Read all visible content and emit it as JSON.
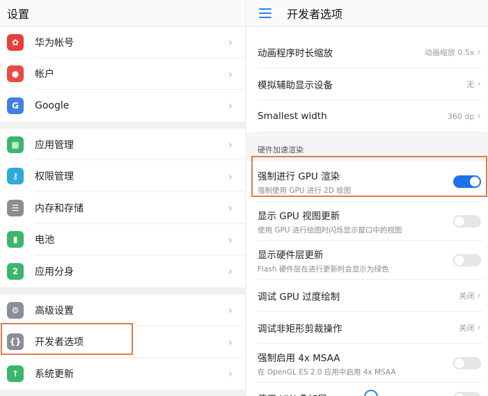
{
  "left": {
    "title": "设置",
    "groups": [
      [
        {
          "label": "华为帐号",
          "icon": "huawei-logo-icon",
          "color": "#e5403b",
          "glyph": "✿"
        },
        {
          "label": "帐户",
          "icon": "account-icon",
          "color": "#e94a43",
          "glyph": "●"
        },
        {
          "label": "Google",
          "icon": "google-icon",
          "color": "#3f7fe6",
          "glyph": "G"
        }
      ],
      [
        {
          "label": "应用管理",
          "icon": "apps-icon",
          "color": "#3cb66a",
          "glyph": "▦"
        },
        {
          "label": "权限管理",
          "icon": "key-icon",
          "color": "#2fa9d8",
          "glyph": "⚷"
        },
        {
          "label": "内存和存储",
          "icon": "storage-icon",
          "color": "#8a8f95",
          "glyph": "☰"
        },
        {
          "label": "电池",
          "icon": "battery-icon",
          "color": "#3cb66a",
          "glyph": "▮"
        },
        {
          "label": "应用分身",
          "icon": "app-twin-icon",
          "color": "#3cb66a",
          "glyph": "2"
        }
      ],
      [
        {
          "label": "高级设置",
          "icon": "gear-icon",
          "color": "#8a8f95",
          "glyph": "⚙"
        },
        {
          "label": "开发者选项",
          "icon": "developer-braces-icon",
          "color": "#8a8f95",
          "glyph": "{}"
        },
        {
          "label": "系统更新",
          "icon": "system-update-icon",
          "color": "#3cb66a",
          "glyph": "↑"
        }
      ]
    ]
  },
  "right": {
    "title": "开发者选项",
    "rows_top": [
      {
        "title": "动画程序时长缩放",
        "value": "动画缩放 0.5x"
      },
      {
        "title": "模拟辅助显示设备",
        "value": "无"
      },
      {
        "title": "Smallest width",
        "value": "360 dp"
      }
    ],
    "section": "硬件加速渲染",
    "rows_hw": [
      {
        "title": "强制进行 GPU 渲染",
        "subtitle": "强制使用 GPU 进行 2D 绘图",
        "toggle": true
      },
      {
        "title": "显示 GPU 视图更新",
        "subtitle": "使用 GPU 进行绘图时闪烁显示窗口中的视图",
        "toggle": false
      },
      {
        "title": "显示硬件层更新",
        "subtitle": "Flash 硬件层在进行更新时会显示为绿色",
        "toggle": false
      },
      {
        "title": "调试 GPU 过度绘制",
        "value": "关闭"
      },
      {
        "title": "调试非矩形剪裁操作",
        "value": "关闭"
      },
      {
        "title": "强制启用 4x MSAA",
        "subtitle": "在 OpenGL ES 2.0 应用中启用 4x MSAA",
        "toggle": false
      },
      {
        "title": "停用 HW 叠加层",
        "toggle": false
      }
    ]
  },
  "colors": {
    "accent": "#1a73e8",
    "highlight": "#e07a4a"
  }
}
